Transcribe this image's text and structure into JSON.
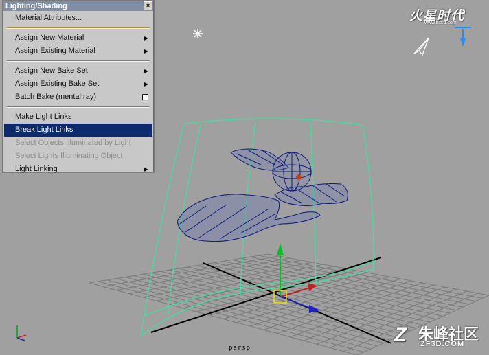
{
  "menu": {
    "title": "Lighting/Shading",
    "close": "×",
    "items": [
      {
        "label": "Material Attributes...",
        "submenu": false,
        "option_box": false,
        "disabled": false,
        "highlighted": false
      },
      {
        "label": "Assign New Material",
        "submenu": true,
        "option_box": false,
        "disabled": false,
        "highlighted": false
      },
      {
        "label": "Assign Existing Material",
        "submenu": true,
        "option_box": false,
        "disabled": false,
        "highlighted": false
      },
      {
        "label": "Assign New Bake Set",
        "submenu": true,
        "option_box": false,
        "disabled": false,
        "highlighted": false
      },
      {
        "label": "Assign Existing Bake Set",
        "submenu": true,
        "option_box": false,
        "disabled": false,
        "highlighted": false
      },
      {
        "label": "Batch Bake (mental ray)",
        "submenu": false,
        "option_box": true,
        "disabled": false,
        "highlighted": false
      },
      {
        "label": "Make Light Links",
        "submenu": false,
        "option_box": false,
        "disabled": false,
        "highlighted": false
      },
      {
        "label": "Break Light Links",
        "submenu": false,
        "option_box": false,
        "disabled": false,
        "highlighted": true
      },
      {
        "label": "Select Objects Illuminated by Light",
        "submenu": false,
        "option_box": false,
        "disabled": true,
        "highlighted": false
      },
      {
        "label": "Select Lights Illuminating Object",
        "submenu": false,
        "option_box": false,
        "disabled": true,
        "highlighted": false
      },
      {
        "label": "Light Linking",
        "submenu": true,
        "option_box": false,
        "disabled": false,
        "highlighted": false
      }
    ]
  },
  "viewport": {
    "camera_label": "persp",
    "background_color": "#a0a0a0",
    "highlight_color": "#0c2a6c",
    "wireframe_color": "#0a1a7a",
    "light_volume_color": "#40e0a0"
  },
  "watermarks": {
    "top_logo": "火星时代",
    "top_url": "www.hxsd.com",
    "bottom_cn": "朱峰社区",
    "bottom_en": "ZF3D.COM"
  }
}
